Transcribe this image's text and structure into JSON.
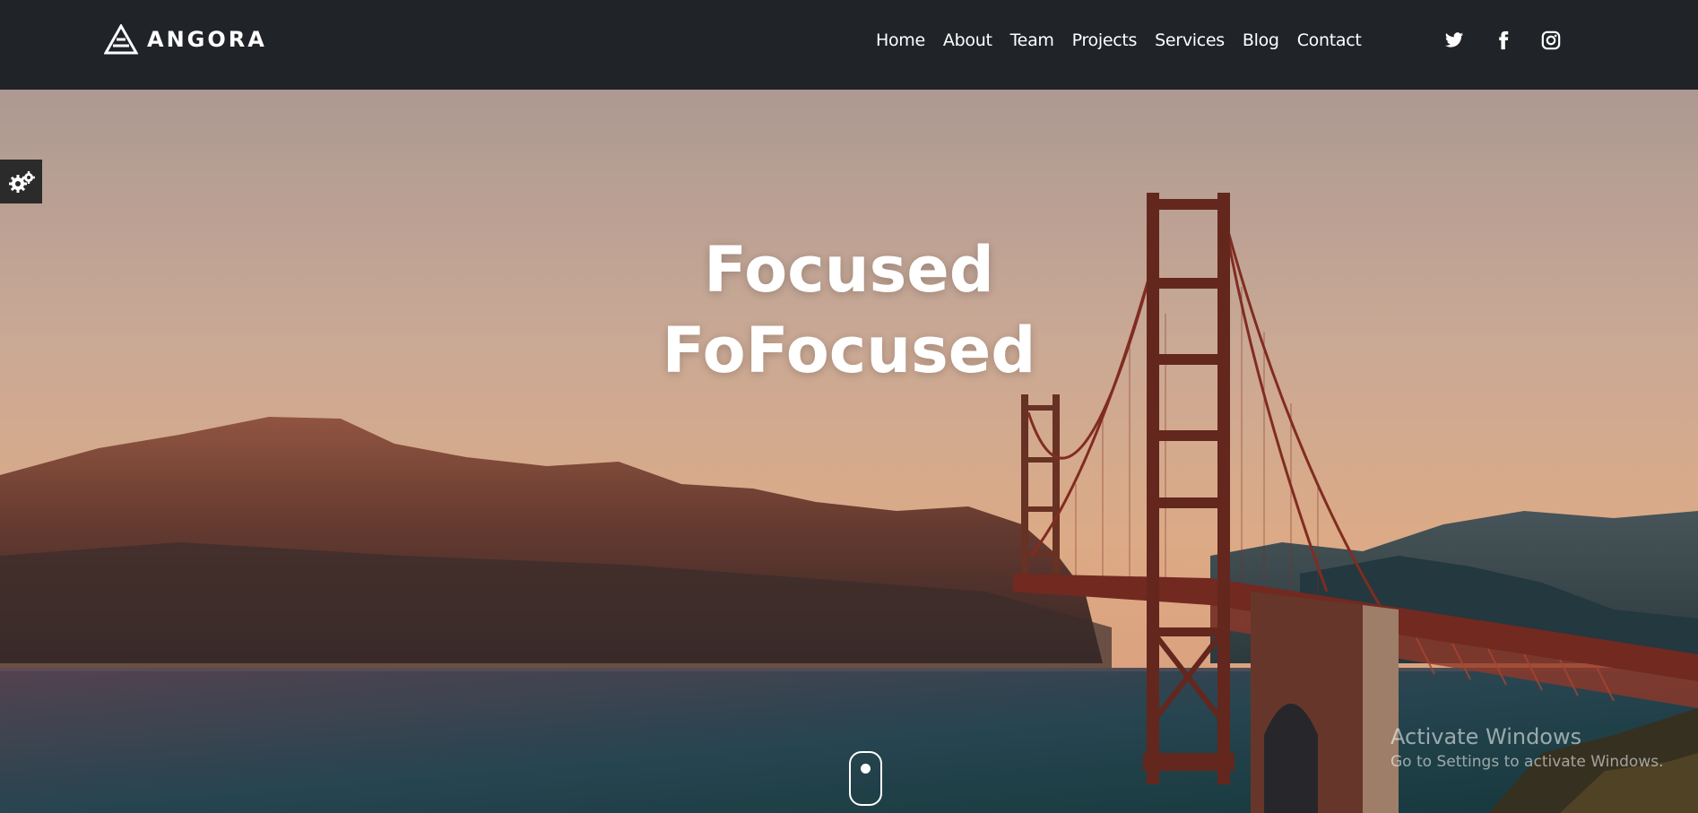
{
  "brand": {
    "name": "ANGORA"
  },
  "nav": {
    "items": [
      {
        "label": "Home"
      },
      {
        "label": "About"
      },
      {
        "label": "Team"
      },
      {
        "label": "Projects"
      },
      {
        "label": "Services"
      },
      {
        "label": "Blog"
      },
      {
        "label": "Contact"
      }
    ]
  },
  "social": {
    "icons": [
      "twitter-icon",
      "facebook-icon",
      "instagram-icon"
    ]
  },
  "hero": {
    "headline_line1": "Focused",
    "headline_line2": "FoFocused"
  },
  "settings": {
    "icon": "gear-icon"
  },
  "watermark": {
    "title": "Activate Windows",
    "subtitle": "Go to Settings to activate Windows."
  },
  "colors": {
    "navbar_bg": "#202328",
    "sky_top": "#bba8a0",
    "sky_bottom": "#e9b593",
    "bridge": "#8a2f24",
    "water": "#1d4b52"
  }
}
